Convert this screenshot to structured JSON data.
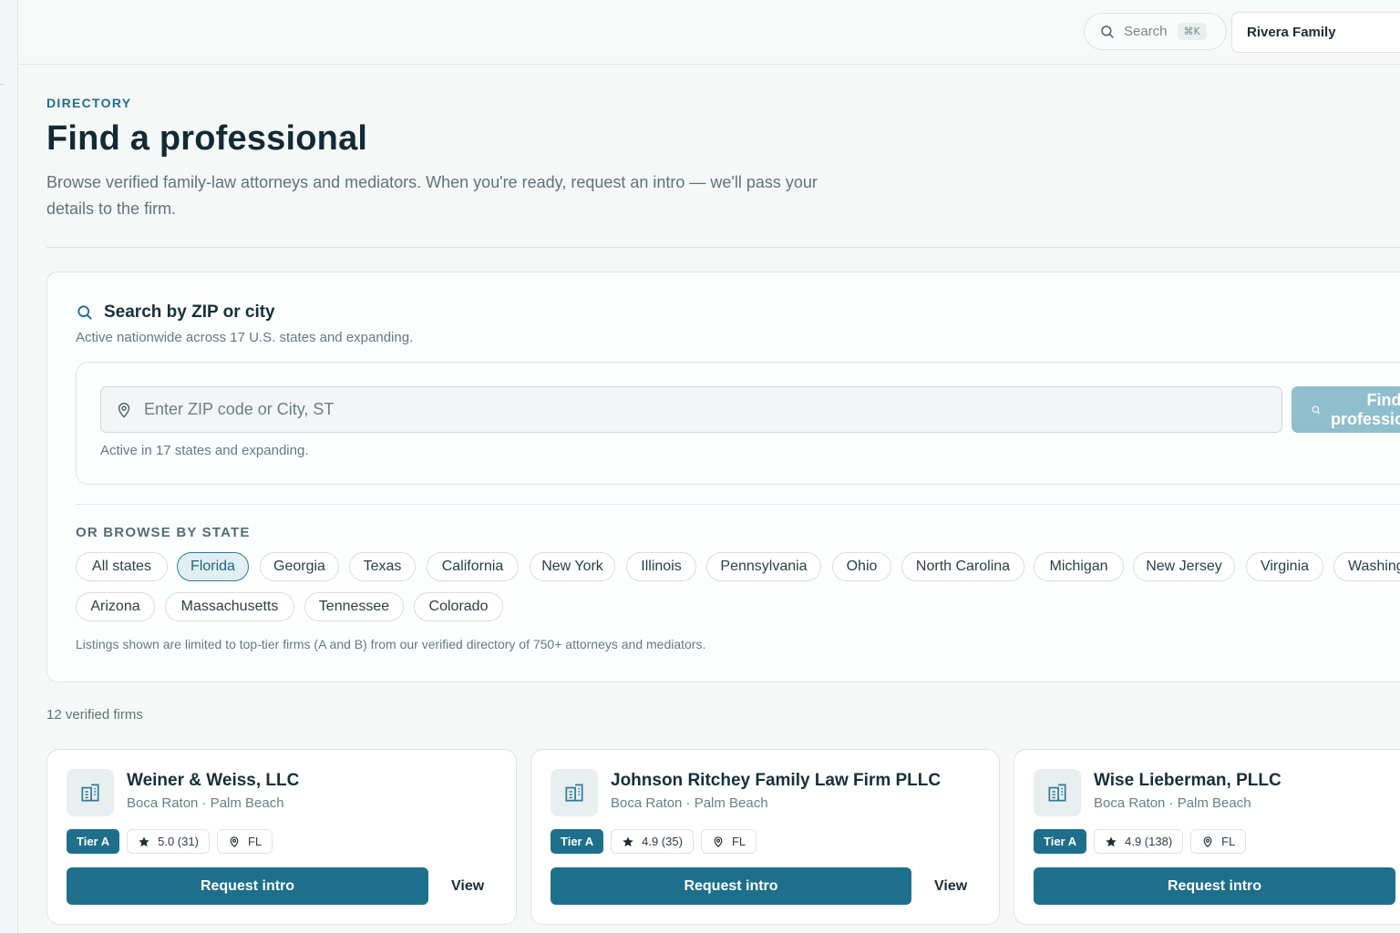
{
  "topbar": {
    "search_label": "Search",
    "search_shortcut": "⌘K",
    "account_name": "Rivera Family"
  },
  "header": {
    "eyebrow": "DIRECTORY",
    "title": "Find a professional",
    "subtitle": "Browse verified family-law attorneys and mediators. When you're ready, request an intro — we'll pass your details to the firm."
  },
  "search": {
    "title": "Search by ZIP or city",
    "subtitle": "Active nationwide across 17 U.S. states and expanding.",
    "placeholder": "Enter ZIP code or City, ST",
    "find_button": "Find professionals",
    "help_text": "Active in 17 states and expanding.",
    "browse_label": "OR BROWSE BY STATE",
    "selected_state": "Florida",
    "states": [
      "All states",
      "Florida",
      "Georgia",
      "Texas",
      "California",
      "New York",
      "Illinois",
      "Pennsylvania",
      "Ohio",
      "North Carolina",
      "Michigan",
      "New Jersey",
      "Virginia",
      "Washington",
      "Arizona",
      "Massachusetts",
      "Tennessee",
      "Colorado"
    ],
    "listing_note": "Listings shown are limited to top-tier firms (A and B) from our verified directory of 750+ attorneys and mediators."
  },
  "results": {
    "count_label": "12 verified firms",
    "request_label": "Request intro",
    "view_label": "View",
    "firms": [
      {
        "name": "Weiner & Weiss, LLC",
        "location": "Boca Raton · Palm Beach",
        "tier": "Tier A",
        "rating": "5.0 (31)",
        "state": "FL"
      },
      {
        "name": "Johnson Ritchey Family Law Firm PLLC",
        "location": "Boca Raton · Palm Beach",
        "tier": "Tier A",
        "rating": "4.9 (35)",
        "state": "FL"
      },
      {
        "name": "Wise Lieberman, PLLC",
        "location": "Boca Raton · Palm Beach",
        "tier": "Tier A",
        "rating": "4.9 (138)",
        "state": "FL"
      }
    ]
  },
  "icons": {
    "search": "search-icon",
    "location": "map-pin-icon",
    "building": "building-icon",
    "star": "star-icon"
  },
  "colors": {
    "accent": "#1e6f8c",
    "accent_disabled": "#8fbecd",
    "chip_active_bg": "#e1eff3",
    "text_primary": "#122a33",
    "text_muted": "#5f7379"
  }
}
